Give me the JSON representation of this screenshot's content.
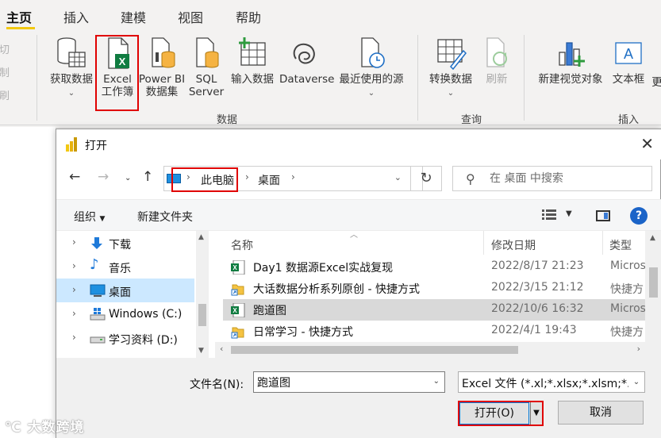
{
  "menu": {
    "tabs": [
      "主页",
      "插入",
      "建模",
      "视图",
      "帮助"
    ]
  },
  "clipboard": {
    "items": [
      "剪切",
      "复制",
      "格式刷"
    ]
  },
  "ribbon": {
    "buttons": {
      "get_data": "获取数据",
      "excel_line1": "Excel",
      "excel_line2": "工作簿",
      "pbi_line1": "Power BI",
      "pbi_line2": "数据集",
      "sql_line1": "SQL",
      "sql_line2": "Server",
      "enter_data": "输入数据",
      "dataverse": "Dataverse",
      "recent_sources": "最近使用的源",
      "transform_data": "转换数据",
      "refresh": "刷新",
      "new_visual": "新建视觉对象",
      "text_box": "文本框",
      "more": "更"
    },
    "groups": {
      "data": "数据",
      "query": "查询",
      "insert": "插入"
    }
  },
  "dialog": {
    "title": "打开",
    "breadcrumb": [
      "此电脑",
      "桌面"
    ],
    "search_placeholder": "在 桌面 中搜索",
    "organize": "组织",
    "new_folder": "新建文件夹",
    "nav_items": [
      {
        "label": "下载",
        "icon": "download-icon"
      },
      {
        "label": "音乐",
        "icon": "music-icon"
      },
      {
        "label": "桌面",
        "icon": "desktop-icon"
      },
      {
        "label": "Windows (C:)",
        "icon": "windows-drive-icon"
      },
      {
        "label": "学习资料 (D:)",
        "icon": "drive-icon"
      }
    ],
    "columns": {
      "name": "名称",
      "date": "修改日期",
      "type": "类型"
    },
    "files": [
      {
        "name": "Day1 数据源Excel实战复现",
        "date": "2022/8/17 21:23",
        "type": "Micros",
        "icon": "excel-file-icon"
      },
      {
        "name": "大话数据分析系列原创 - 快捷方式",
        "date": "2022/3/15 21:12",
        "type": "快捷方",
        "icon": "shortcut-icon"
      },
      {
        "name": "跑道图",
        "date": "2022/10/6 16:32",
        "type": "Micros",
        "icon": "excel-file-icon"
      },
      {
        "name": "日常学习 - 快捷方式",
        "date": "2022/4/1 19:43",
        "type": "快捷方",
        "icon": "shortcut-icon"
      }
    ],
    "filename_label": "文件名(N):",
    "filename_value": "跑道图",
    "filter_value": "Excel 文件 (*.xl;*.xlsx;*.xlsm;*.",
    "open_label": "打开(O)",
    "cancel_label": "取消"
  },
  "watermark": "大数跨境"
}
